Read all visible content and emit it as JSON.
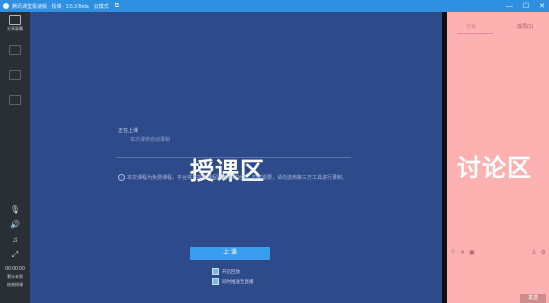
{
  "titlebar": {
    "app_title": "腾讯课堂极速版 · 授课 · 3.5.3 Beta",
    "mode": "云模式",
    "controls": [
      "—",
      "☐",
      "✕"
    ]
  },
  "sidebar": {
    "items": [
      {
        "label": "分享屏幕",
        "icon": "share-screen-icon"
      },
      {
        "label": "",
        "icon": "ppt-icon"
      },
      {
        "label": "",
        "icon": "video-icon"
      },
      {
        "label": "",
        "icon": "camera-icon"
      }
    ],
    "bottom": {
      "mic_icon": "🎙",
      "speaker_icon": "🔊",
      "music_icon": "♫",
      "expand_icon": "⤢",
      "timer": "00:00:00",
      "line1": "累计未到",
      "line2": "结束授课"
    }
  },
  "stage": {
    "title": "正在上课",
    "subtitle": "本次课将自动录制",
    "zone_label": "授课区",
    "notice": "本次课程为免费课程，平台将不提供课程回放录制功能，如有需要，请勿选用第三方工具进行录制。",
    "start_button": "上 课",
    "options": [
      "开启回放",
      "同时推送至直播"
    ]
  },
  "panel": {
    "tabs": [
      "讨论",
      "成员(1)"
    ],
    "zone_label": "讨论区",
    "send_button": "发送"
  },
  "colors": {
    "titlebar": "#2f8fe0",
    "stage": "#2d4a8a",
    "panel": "#fdb1b1",
    "button": "#3a9ef0"
  }
}
